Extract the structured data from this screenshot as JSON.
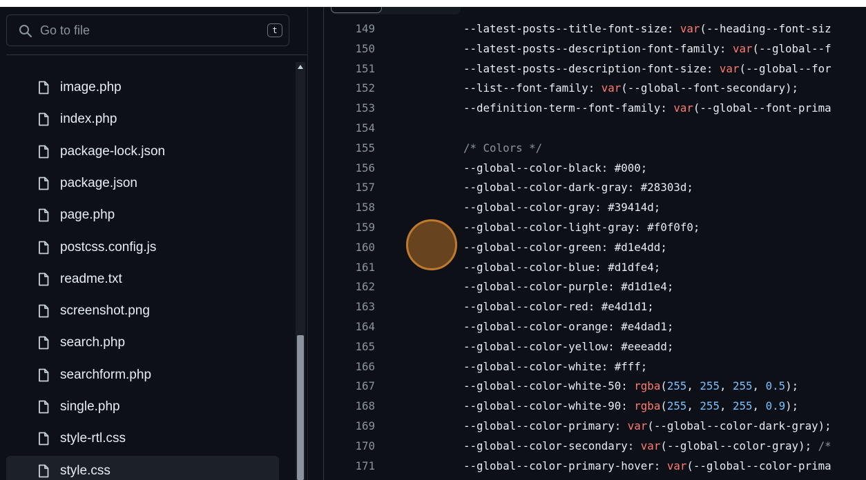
{
  "search": {
    "placeholder": "Go to file",
    "shortcut": "t"
  },
  "files": [
    {
      "name": "image.php"
    },
    {
      "name": "index.php"
    },
    {
      "name": "package-lock.json"
    },
    {
      "name": "package.json"
    },
    {
      "name": "page.php"
    },
    {
      "name": "postcss.config.js"
    },
    {
      "name": "readme.txt"
    },
    {
      "name": "screenshot.png"
    },
    {
      "name": "search.php"
    },
    {
      "name": "searchform.php"
    },
    {
      "name": "single.php"
    },
    {
      "name": "style-rtl.css"
    },
    {
      "name": "style.css",
      "selected": true
    }
  ],
  "code": [
    {
      "n": "149",
      "t": [
        [
          "p",
          "--latest-posts--title-font-size: "
        ],
        [
          "f",
          "var"
        ],
        [
          "p",
          "(--heading--font-siz"
        ]
      ]
    },
    {
      "n": "150",
      "t": [
        [
          "p",
          "--latest-posts--description-font-family: "
        ],
        [
          "f",
          "var"
        ],
        [
          "p",
          "(--global--f"
        ]
      ]
    },
    {
      "n": "151",
      "t": [
        [
          "p",
          "--latest-posts--description-font-size: "
        ],
        [
          "f",
          "var"
        ],
        [
          "p",
          "(--global--for"
        ]
      ]
    },
    {
      "n": "152",
      "t": [
        [
          "p",
          "--list--font-family: "
        ],
        [
          "f",
          "var"
        ],
        [
          "p",
          "(--global--font-secondary);"
        ]
      ]
    },
    {
      "n": "153",
      "t": [
        [
          "p",
          "--definition-term--font-family: "
        ],
        [
          "f",
          "var"
        ],
        [
          "p",
          "(--global--font-prima"
        ]
      ]
    },
    {
      "n": "154",
      "t": []
    },
    {
      "n": "155",
      "t": [
        [
          "c",
          "/* Colors */"
        ]
      ]
    },
    {
      "n": "156",
      "t": [
        [
          "p",
          "--global--color-black: #000;"
        ]
      ]
    },
    {
      "n": "157",
      "t": [
        [
          "p",
          "--global--color-dark-gray: #28303d;"
        ]
      ]
    },
    {
      "n": "158",
      "t": [
        [
          "p",
          "--global--color-gray: #39414d;"
        ]
      ]
    },
    {
      "n": "159",
      "t": [
        [
          "p",
          "--global--color-light-gray: #f0f0f0;"
        ]
      ]
    },
    {
      "n": "160",
      "t": [
        [
          "p",
          "--global--color-green: #d1e4dd;"
        ]
      ]
    },
    {
      "n": "161",
      "t": [
        [
          "p",
          "--global--color-blue: #d1dfe4;"
        ]
      ]
    },
    {
      "n": "162",
      "t": [
        [
          "p",
          "--global--color-purple: #d1d1e4;"
        ]
      ]
    },
    {
      "n": "163",
      "t": [
        [
          "p",
          "--global--color-red: #e4d1d1;"
        ]
      ]
    },
    {
      "n": "164",
      "t": [
        [
          "p",
          "--global--color-orange: #e4dad1;"
        ]
      ]
    },
    {
      "n": "165",
      "t": [
        [
          "p",
          "--global--color-yellow: #eeeadd;"
        ]
      ]
    },
    {
      "n": "166",
      "t": [
        [
          "p",
          "--global--color-white: #fff;"
        ]
      ]
    },
    {
      "n": "167",
      "t": [
        [
          "p",
          "--global--color-white-50: "
        ],
        [
          "f",
          "rgba"
        ],
        [
          "p",
          "("
        ],
        [
          "n",
          "255"
        ],
        [
          "p",
          ", "
        ],
        [
          "n",
          "255"
        ],
        [
          "p",
          ", "
        ],
        [
          "n",
          "255"
        ],
        [
          "p",
          ", "
        ],
        [
          "n",
          "0.5"
        ],
        [
          "p",
          ");"
        ]
      ]
    },
    {
      "n": "168",
      "t": [
        [
          "p",
          "--global--color-white-90: "
        ],
        [
          "f",
          "rgba"
        ],
        [
          "p",
          "("
        ],
        [
          "n",
          "255"
        ],
        [
          "p",
          ", "
        ],
        [
          "n",
          "255"
        ],
        [
          "p",
          ", "
        ],
        [
          "n",
          "255"
        ],
        [
          "p",
          ", "
        ],
        [
          "n",
          "0.9"
        ],
        [
          "p",
          ");"
        ]
      ]
    },
    {
      "n": "169",
      "t": [
        [
          "p",
          "--global--color-primary: "
        ],
        [
          "f",
          "var"
        ],
        [
          "p",
          "(--global--color-dark-gray);"
        ]
      ]
    },
    {
      "n": "170",
      "t": [
        [
          "p",
          "--global--color-secondary: "
        ],
        [
          "f",
          "var"
        ],
        [
          "p",
          "(--global--color-gray); "
        ],
        [
          "c",
          "/*"
        ]
      ]
    },
    {
      "n": "171",
      "t": [
        [
          "p",
          "--global--color-primary-hover: "
        ],
        [
          "f",
          "var"
        ],
        [
          "p",
          "(--global--color-prima"
        ]
      ]
    }
  ]
}
